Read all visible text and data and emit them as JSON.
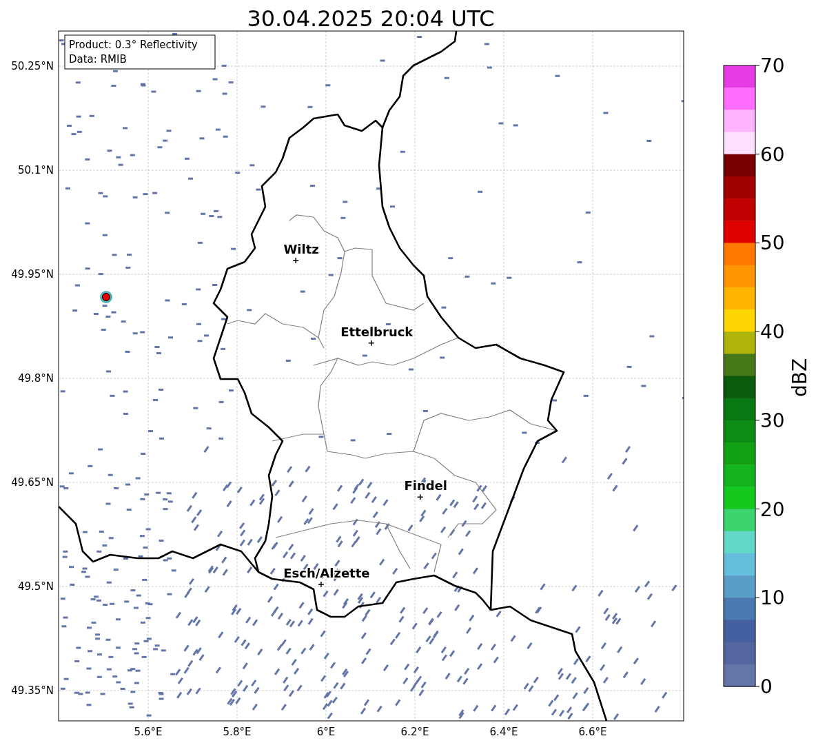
{
  "title": "30.04.2025 20:04 UTC",
  "info_box": [
    "Product: 0.3° Reflectivity",
    "Data: RMIB"
  ],
  "map": {
    "x_ticks": [
      "5.6°E",
      "5.8°E",
      "6°E",
      "6.2°E",
      "6.4°E",
      "6.6°E"
    ],
    "y_ticks": [
      "50.25°N",
      "50.1°N",
      "49.95°N",
      "49.8°N",
      "49.65°N",
      "49.5°N",
      "49.35°N"
    ],
    "cities": [
      "Wiltz",
      "Ettelbruck",
      "Findel",
      "Esch/Alzette"
    ]
  },
  "colorbar": {
    "label": "dBZ",
    "ticks": [
      "70",
      "60",
      "50",
      "40",
      "30",
      "20",
      "10",
      "0"
    ],
    "bins": [
      {
        "color": "#e63ce6"
      },
      {
        "color": "#ff6eff"
      },
      {
        "color": "#ffb4ff"
      },
      {
        "color": "#ffe1ff"
      },
      {
        "color": "#780000"
      },
      {
        "color": "#a00000"
      },
      {
        "color": "#c00000"
      },
      {
        "color": "#e10000"
      },
      {
        "color": "#ff7800"
      },
      {
        "color": "#ff9600"
      },
      {
        "color": "#ffb400"
      },
      {
        "color": "#ffd700"
      },
      {
        "color": "#afb40a"
      },
      {
        "color": "#46781a"
      },
      {
        "color": "#0a5c0c"
      },
      {
        "color": "#0a7812"
      },
      {
        "color": "#0c8c14"
      },
      {
        "color": "#14a014"
      },
      {
        "color": "#14b41e"
      },
      {
        "color": "#14c81e"
      },
      {
        "color": "#3cd46e"
      },
      {
        "color": "#64d8c8"
      },
      {
        "color": "#64bedc"
      },
      {
        "color": "#5a9ec8"
      },
      {
        "color": "#4a78b0"
      },
      {
        "color": "#4560a0"
      },
      {
        "color": "#5366a0"
      },
      {
        "color": "#6475a8"
      }
    ]
  }
}
